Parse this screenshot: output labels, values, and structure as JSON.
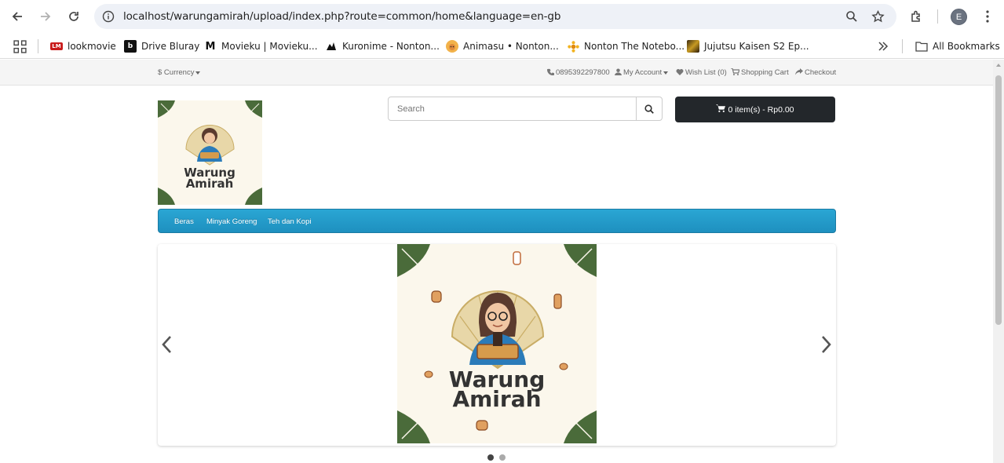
{
  "browser": {
    "url": "localhost/warungamirah/upload/index.php?route=common/home&language=en-gb",
    "profile_initial": "E",
    "bookmarks": [
      {
        "label": "lookmovie",
        "icon": "lookmovie-favicon"
      },
      {
        "label": "Drive Bluray",
        "icon": "drive-bluray-favicon"
      },
      {
        "label": "Movieku | Movieku...",
        "icon": "movieku-favicon"
      },
      {
        "label": "Kuronime - Nonton...",
        "icon": "kuronime-favicon"
      },
      {
        "label": "Animasu • Nonton...",
        "icon": "animasu-favicon"
      },
      {
        "label": "Nonton The Notebo...",
        "icon": "notebook-favicon"
      },
      {
        "label": "Jujutsu Kaisen S2 Ep...",
        "icon": "jujutsu-favicon"
      }
    ],
    "all_bookmarks_label": "All Bookmarks"
  },
  "topbar": {
    "currency_label": "$ Currency",
    "phone": "0895392297800",
    "my_account": "My Account",
    "wishlist": "Wish List (0)",
    "shopping_cart": "Shopping Cart",
    "checkout": "Checkout"
  },
  "header": {
    "logo_line1": "Warung",
    "logo_line2": "Amirah",
    "search_placeholder": "Search",
    "cart_label": "0 item(s) - Rp0.00"
  },
  "menu": {
    "items": [
      "Beras",
      "Minyak Goreng",
      "Teh dan Kopi"
    ]
  },
  "slider": {
    "banner_line1": "Warung",
    "banner_line2": "Amirah",
    "slide_count": 2,
    "active_slide": 1
  },
  "colors": {
    "menu_blue": "#229ac8",
    "cart_dark": "#23272b",
    "logo_green": "#4a6b3a",
    "logo_blue": "#2b7bb9"
  }
}
